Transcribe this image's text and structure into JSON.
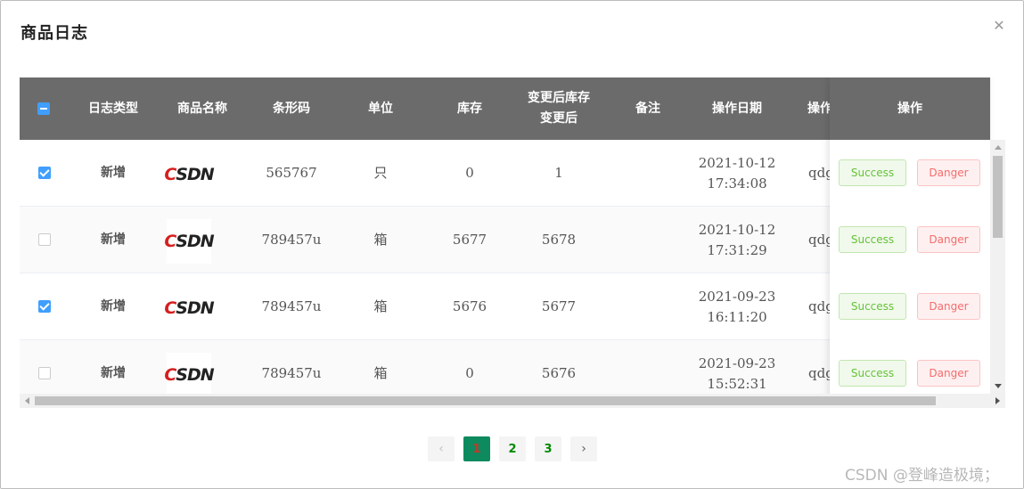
{
  "dialog": {
    "title": "商品日志",
    "close_icon": "close-icon"
  },
  "table": {
    "columns": [
      "日志类型",
      "商品名称",
      "条形码",
      "单位",
      "库存",
      "变更后库存变更后",
      "备注",
      "操作日期",
      "操作人",
      "操作"
    ],
    "header": {
      "type": "日志类型",
      "name": "商品名称",
      "barcode": "条形码",
      "unit": "单位",
      "stock": "库存",
      "after_line1": "变更后库存",
      "after_line2": "变更后",
      "remark": "备注",
      "date": "操作日期",
      "operator": "操作",
      "action": "操作"
    },
    "rows": [
      {
        "checked": true,
        "type": "新增",
        "logo": "CSDN",
        "barcode": "565767",
        "unit": "只",
        "stock": "0",
        "after": "1",
        "remark": "",
        "date1": "2021-10-12",
        "date2": "17:34:08",
        "operator": "qdg"
      },
      {
        "checked": false,
        "type": "新增",
        "logo": "CSDN",
        "barcode": "789457u",
        "unit": "箱",
        "stock": "5677",
        "after": "5678",
        "remark": "",
        "date1": "2021-10-12",
        "date2": "17:31:29",
        "operator": "qdg"
      },
      {
        "checked": true,
        "type": "新增",
        "logo": "CSDN",
        "barcode": "789457u",
        "unit": "箱",
        "stock": "5676",
        "after": "5677",
        "remark": "",
        "date1": "2021-09-23",
        "date2": "16:11:20",
        "operator": "qdg"
      },
      {
        "checked": false,
        "type": "新增",
        "logo": "CSDN",
        "barcode": "789457u",
        "unit": "箱",
        "stock": "0",
        "after": "5676",
        "remark": "",
        "date1": "2021-09-23",
        "date2": "15:52:31",
        "operator": "qdg"
      }
    ],
    "buttons": {
      "success": "Success",
      "danger": "Danger"
    }
  },
  "pagination": {
    "prev": "‹",
    "pages": [
      "1",
      "2",
      "3"
    ],
    "current": "1",
    "next": "›"
  },
  "watermark": "CSDN @登峰造极境；",
  "colors": {
    "header_bg": "#6b6b6b",
    "checkbox": "#409eff",
    "success": "#67c23a",
    "danger": "#f56c6c",
    "page_active": "#0e8a5f"
  }
}
